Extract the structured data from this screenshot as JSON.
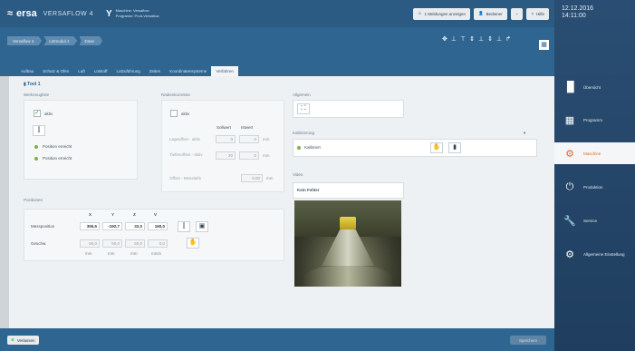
{
  "header": {
    "brand": "ersa",
    "product": "VERSAFLOW 4",
    "machine_line1": "Maschine: Versaflow",
    "machine_line2": "Programm: Prod-Versaflow",
    "messages_label": "1 Meldungen anzeigen",
    "user_label": "Bediener",
    "help_label": "Hilfe"
  },
  "clock": {
    "date": "12.12.2016",
    "time": "14:11:00"
  },
  "sidebar": {
    "items": [
      {
        "label": "Übersicht",
        "icon": "bar-chart-icon"
      },
      {
        "label": "Programm",
        "icon": "program-icon"
      },
      {
        "label": "Maschine",
        "icon": "gears-icon"
      },
      {
        "label": "Produktion",
        "icon": "power-icon"
      },
      {
        "label": "Service",
        "icon": "tools-icon"
      },
      {
        "label": "Allgemeine Einstellung",
        "icon": "settings-icon"
      }
    ]
  },
  "breadcrumb": [
    "Versaflow 4",
    "Lötmodul 1",
    "Düse"
  ],
  "tabs": [
    "Aufbau",
    "Schutz & Ofen",
    "Luft",
    "Lötstoff",
    "Lotzuführung",
    "Zeiten",
    "Koordinatensysteme",
    "Verfahren"
  ],
  "active_tab": 7,
  "main": {
    "tool_header": "Tool 1",
    "section_tool": "Werkzeugliste",
    "active_label": "aktiv",
    "status_1": "Position erreicht",
    "status_2": "Position erreicht",
    "section_offset": "Radienkorrektur",
    "offset_active": "aktiv",
    "col_set": "Sollwert",
    "col_actual": "Istwert",
    "row1_label": "Lageoffset - aktiv",
    "row1_set": "0",
    "row1_actual": "0",
    "row1_unit": "mm",
    "row2_label": "Tiefenoffset - aktiv",
    "row2_set": "20",
    "row2_actual": "0",
    "row2_unit": "mm",
    "row3_label": "Offset - Messtiefe",
    "row3_value": "0,00",
    "row3_unit": "mm",
    "section_position": "Positionen",
    "axes": [
      "X",
      "Y",
      "Z",
      "V"
    ],
    "pos_label": "Messposition",
    "pos_values": [
      "355,5",
      "-192,7",
      "32,0",
      "160,0"
    ],
    "speed_label": "Geschw.",
    "speed_values": [
      "50,0",
      "50,0",
      "50,0",
      "0,0"
    ],
    "units": [
      "mm",
      "mm",
      "mm",
      "mm/s"
    ],
    "section_general": "Allgemein",
    "section_calibration": "Kalibrierung",
    "calib_status": "Kalibriert",
    "section_video": "Video",
    "video_status": "Kein Fehler"
  },
  "footer": {
    "left_button": "Verlassen",
    "right_button": "Speichern"
  }
}
